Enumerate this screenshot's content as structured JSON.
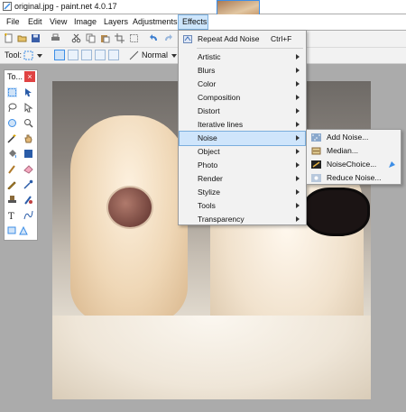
{
  "window": {
    "title": "original.jpg - paint.net 4.0.17"
  },
  "menubar": {
    "items": [
      "File",
      "Edit",
      "View",
      "Image",
      "Layers",
      "Adjustments",
      "Effects"
    ],
    "active": "Effects"
  },
  "toolbar2": {
    "tool_label": "Tool:",
    "blend_mode": "Normal"
  },
  "tools_window": {
    "title": "To...",
    "close": "×"
  },
  "effects_menu": {
    "repeat": {
      "label": "Repeat Add Noise",
      "shortcut": "Ctrl+F"
    },
    "items": [
      "Artistic",
      "Blurs",
      "Color",
      "Composition",
      "Distort",
      "Iterative lines",
      "Noise",
      "Object",
      "Photo",
      "Render",
      "Stylize",
      "Tools",
      "Transparency"
    ],
    "highlighted": "Noise"
  },
  "noise_submenu": {
    "items": [
      "Add Noise...",
      "Median...",
      "NoiseChoice...",
      "Reduce Noise..."
    ]
  },
  "colors": {
    "accent": "#3d8ee6",
    "highlight": "#cfe5fb",
    "close": "#e04343"
  }
}
